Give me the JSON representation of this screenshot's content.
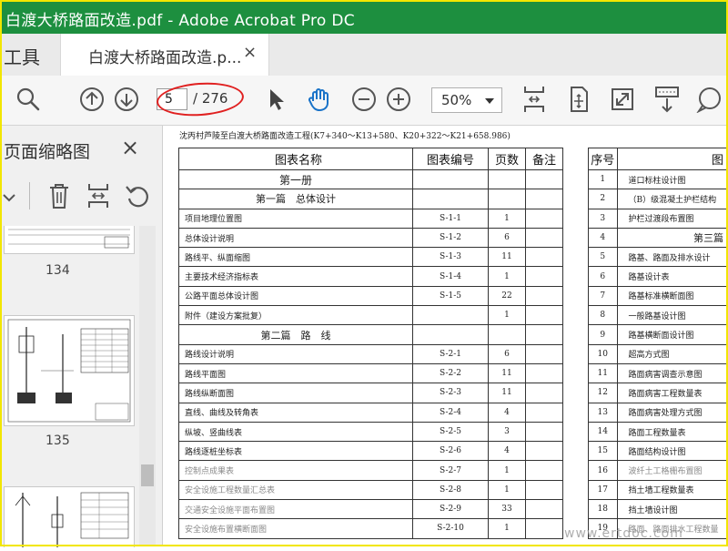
{
  "window": {
    "title": "白渡大桥路面改造.pdf - Adobe Acrobat Pro DC"
  },
  "tabs": {
    "tools_label": "工具",
    "doc_tab_label": "白渡大桥路面改造.p...",
    "close_glyph": "×"
  },
  "toolbar": {
    "current_page": "5",
    "total_pages": "/ 276",
    "zoom": "50%",
    "icons": [
      "search-icon",
      "page-up-icon",
      "page-down-icon",
      "select-cursor-icon",
      "hand-tool-icon",
      "zoom-out-icon",
      "zoom-in-icon",
      "fit-page-icon",
      "rotate-view-icon",
      "fullscreen-icon",
      "scroll-mode-icon",
      "comment-icon"
    ]
  },
  "sidebar": {
    "title": "页面缩略图",
    "close_glyph": "×",
    "thumbnails": [
      {
        "page": "134"
      },
      {
        "page": "135"
      },
      {
        "page": ""
      }
    ]
  },
  "document": {
    "header": "沈丙村芦陵至白渡大桥路面改造工程(K7+340～K13+580、K20+322～K21+658.986)",
    "left_table": {
      "columns": [
        "图表名称",
        "图表编号",
        "页数",
        "备注"
      ],
      "rows": [
        {
          "type": "book",
          "name": "第一册",
          "code": "",
          "pages": "",
          "note": ""
        },
        {
          "type": "section",
          "name": "第一篇　总体设计",
          "code": "",
          "pages": "",
          "note": ""
        },
        {
          "type": "item",
          "name": "项目地理位置图",
          "code": "S-1-1",
          "pages": "1",
          "note": ""
        },
        {
          "type": "item",
          "name": "总体设计说明",
          "code": "S-1-2",
          "pages": "6",
          "note": ""
        },
        {
          "type": "item",
          "name": "路线平、纵面缩图",
          "code": "S-1-3",
          "pages": "11",
          "note": ""
        },
        {
          "type": "item",
          "name": "主要技术经济指标表",
          "code": "S-1-4",
          "pages": "1",
          "note": ""
        },
        {
          "type": "item",
          "name": "公路平面总体设计图",
          "code": "S-1-5",
          "pages": "22",
          "note": ""
        },
        {
          "type": "item",
          "name": "附件（建设方案批复）",
          "code": "",
          "pages": "1",
          "note": ""
        },
        {
          "type": "section",
          "name": "第二篇　路　线",
          "code": "",
          "pages": "",
          "note": ""
        },
        {
          "type": "item",
          "name": "路线设计说明",
          "code": "S-2-1",
          "pages": "6",
          "note": ""
        },
        {
          "type": "item",
          "name": "路线平面图",
          "code": "S-2-2",
          "pages": "11",
          "note": ""
        },
        {
          "type": "item",
          "name": "路线纵断面图",
          "code": "S-2-3",
          "pages": "11",
          "note": ""
        },
        {
          "type": "item",
          "name": "直线、曲线及转角表",
          "code": "S-2-4",
          "pages": "4",
          "note": ""
        },
        {
          "type": "item",
          "name": "纵坡、竖曲线表",
          "code": "S-2-5",
          "pages": "3",
          "note": ""
        },
        {
          "type": "item",
          "name": "路线逐桩坐标表",
          "code": "S-2-6",
          "pages": "4",
          "note": ""
        },
        {
          "type": "item",
          "name": "控制点成果表",
          "code": "S-2-7",
          "pages": "1",
          "note": ""
        },
        {
          "type": "item",
          "name": "安全设施工程数量汇总表",
          "code": "S-2-8",
          "pages": "1",
          "note": ""
        },
        {
          "type": "item",
          "name": "交通安全设施平面布置图",
          "code": "S-2-9",
          "pages": "33",
          "note": ""
        },
        {
          "type": "item",
          "name": "安全设施布置横断面图",
          "code": "S-2-10",
          "pages": "1",
          "note": ""
        }
      ]
    },
    "right_table": {
      "columns": [
        "序号",
        "图"
      ],
      "rows": [
        {
          "no": "1",
          "name": "道口标柱设计图"
        },
        {
          "no": "2",
          "name": "（B）级混凝土护栏结构"
        },
        {
          "no": "3",
          "name": "护栏过渡段布置图"
        },
        {
          "no": "4",
          "name": "第三篇"
        },
        {
          "no": "5",
          "name": "路基、路面及排水设计"
        },
        {
          "no": "6",
          "name": "路基设计表"
        },
        {
          "no": "7",
          "name": "路基标准横断面图"
        },
        {
          "no": "8",
          "name": "一般路基设计图"
        },
        {
          "no": "9",
          "name": "路基横断面设计图"
        },
        {
          "no": "10",
          "name": "超高方式图"
        },
        {
          "no": "11",
          "name": "路面病害调查示意图"
        },
        {
          "no": "12",
          "name": "路面病害工程数量表"
        },
        {
          "no": "13",
          "name": "路面病害处理方式图"
        },
        {
          "no": "14",
          "name": "路面工程数量表"
        },
        {
          "no": "15",
          "name": "路面结构设计图"
        },
        {
          "no": "16",
          "name": "波纤土工格栅布置图"
        },
        {
          "no": "17",
          "name": "挡土墙工程数量表"
        },
        {
          "no": "18",
          "name": "挡土墙设计图"
        },
        {
          "no": "19",
          "name": "路面、路面排水工程数量"
        }
      ]
    }
  },
  "watermark": "www.ertdoc.com",
  "colors": {
    "titlebar": "#1d8f3f",
    "annotation_oval": "#e02020",
    "frame": "#f2e600"
  }
}
